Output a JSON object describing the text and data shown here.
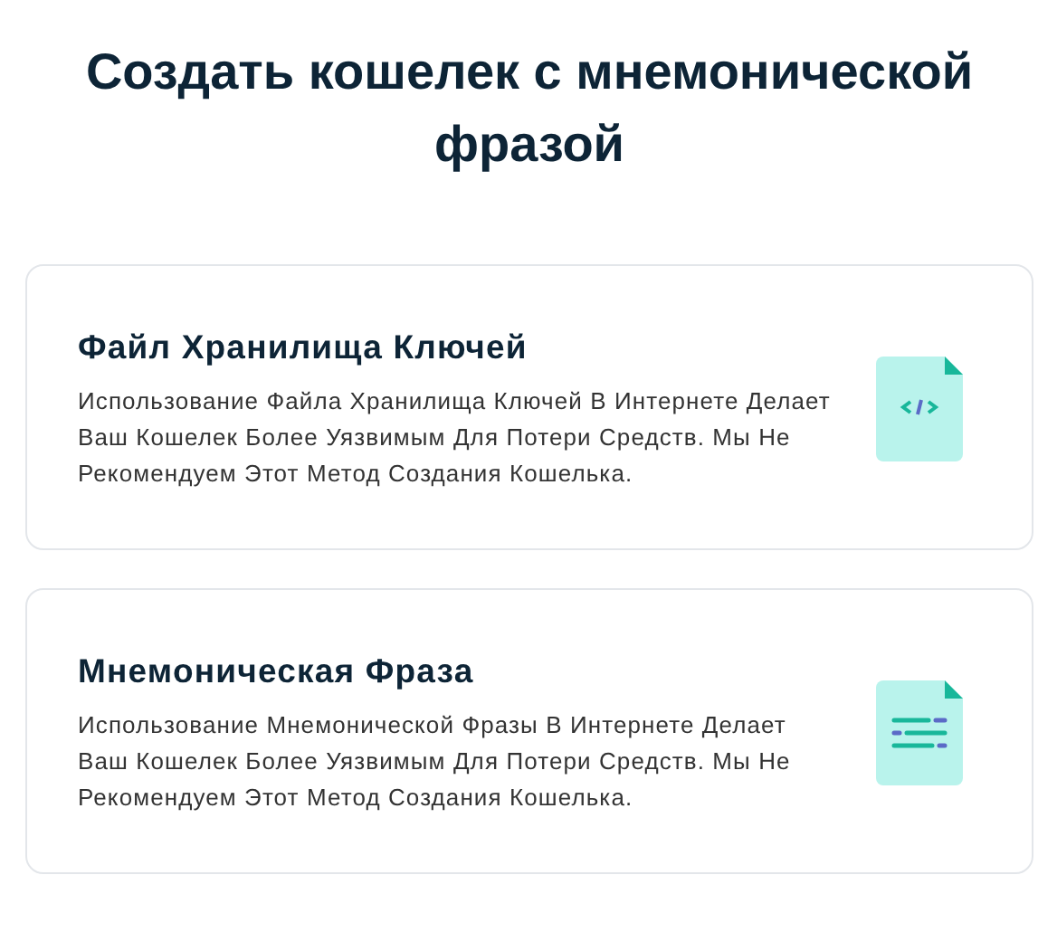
{
  "title": "Создать кошелек с мнемонической фразой",
  "options": [
    {
      "kind": "code",
      "title": "Файл Хранилища Ключей",
      "description": "Использование Файла Хранилища Ключей В Интернете Делает Ваш Кошелек Более Уязвимым Для Потери Средств. Мы Не Рекомендуем Этот Метод Создания Кошелька."
    },
    {
      "kind": "text",
      "title": "Мнемоническая Фраза",
      "description": "Использование Мнемонической Фразы В Интернете Делает Ваш Кошелек Более Уязвимым Для Потери Средств. Мы Не Рекомендуем Этот Метод Создания Кошелька."
    }
  ]
}
